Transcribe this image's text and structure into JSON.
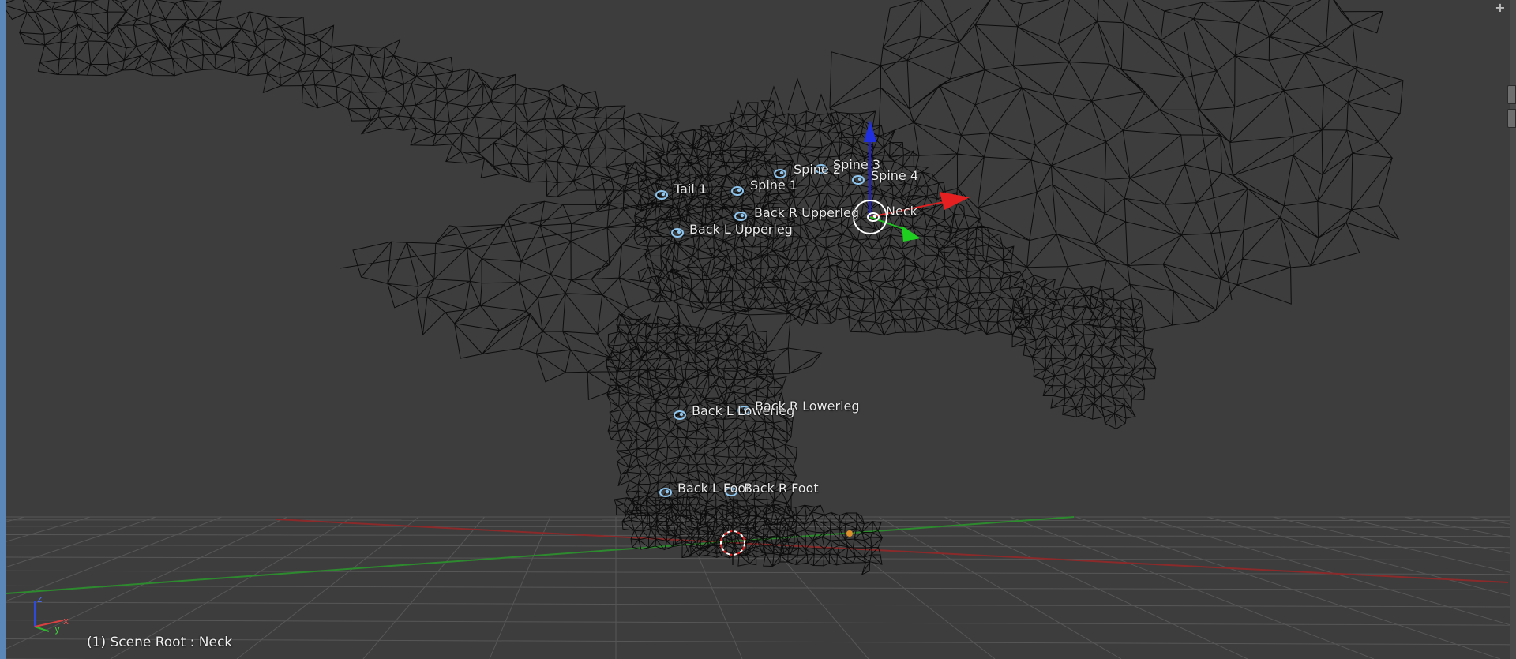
{
  "viewport": {
    "status_text": "(1) Scene Root : Neck",
    "background_color": "#3d3d3d",
    "wire_color": "#0a0a0a",
    "bone_icon_color": "#8ec6f0",
    "active_bone_color": "#ffffff",
    "x_axis_color": "#e02020",
    "y_axis_color": "#20c020",
    "z_axis_color": "#2020d0"
  },
  "bones": [
    {
      "id": "tail-1",
      "label": "Tail 1"
    },
    {
      "id": "spine-1",
      "label": "Spine 1"
    },
    {
      "id": "spine-2",
      "label": "Spine 2"
    },
    {
      "id": "spine-3",
      "label": "Spine 3"
    },
    {
      "id": "spine-4",
      "label": "Spine 4"
    },
    {
      "id": "back-r-upperleg",
      "label": "Back R Upperleg"
    },
    {
      "id": "neck",
      "label": "Neck"
    },
    {
      "id": "back-l-upperleg",
      "label": "Back L Upperleg"
    },
    {
      "id": "back-l-lowerleg",
      "label": "Back L Lowerleg"
    },
    {
      "id": "back-r-lowerleg",
      "label": "Back R Lowerleg"
    },
    {
      "id": "back-l-foot",
      "label": "Back L Foot"
    },
    {
      "id": "back-r-foot",
      "label": "Back R Foot"
    }
  ],
  "active_bone": "Neck",
  "corner_button": {
    "icon": "plus-icon",
    "glyph": "+"
  },
  "orientation_gizmo": {
    "z_label": "z",
    "y_label": "y",
    "x_label": "x"
  }
}
